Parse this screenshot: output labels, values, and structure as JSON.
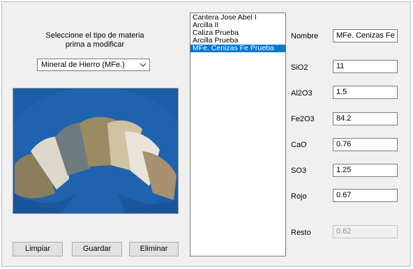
{
  "prompt": {
    "line1": "Seleccione el tipo de materia",
    "line2": "prima a modificar"
  },
  "material_type": {
    "selected": "Mineral de Hierro (MFe.)"
  },
  "buttons": {
    "clear": "Limpiar",
    "save": "Guardar",
    "delete": "Eliminar"
  },
  "materials_list": {
    "items": [
      "Cantera Jose Abel I",
      "Arcilla II",
      "Caliza Prueba",
      "Arcilla Prueba",
      "MFe. Cenizas Fe Prueba"
    ],
    "selected_index": 4
  },
  "fields": {
    "nombre": {
      "label": "Nombre",
      "value": "MFe. Cenizas Fe Prueba"
    },
    "sio2": {
      "label": "SiO2",
      "value": "11"
    },
    "al2o3": {
      "label": "Al2O3",
      "value": "1.5"
    },
    "fe2o3": {
      "label": "Fe2O3",
      "value": "84.2"
    },
    "cao": {
      "label": "CaO",
      "value": "0.76"
    },
    "so3": {
      "label": "SO3",
      "value": "1.25"
    },
    "rojo": {
      "label": "Rojo",
      "value": "0.67"
    },
    "resto": {
      "label": "Resto",
      "value": "0.62"
    }
  },
  "colors": {
    "selection": "#0078d7",
    "form_bg": "#f0f0f0",
    "photo_bg": "#1b5ea8"
  },
  "image": {
    "subject": "raw materials powder samples photo"
  }
}
